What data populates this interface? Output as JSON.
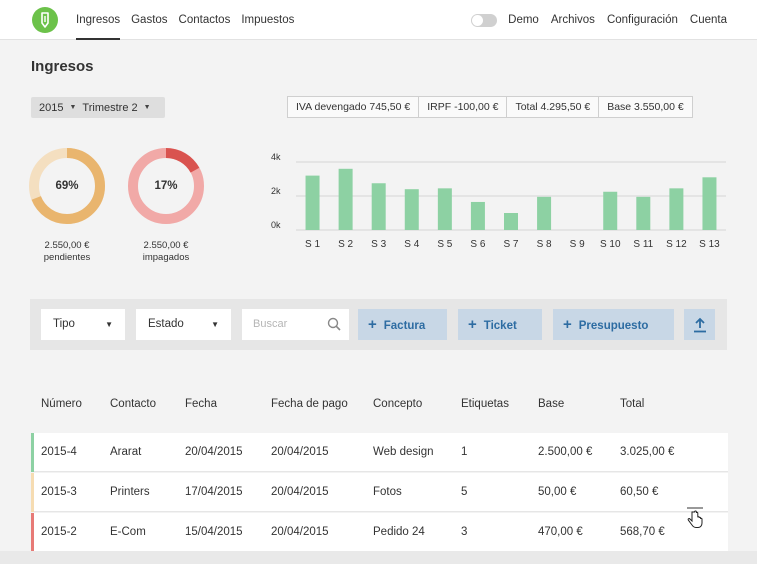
{
  "nav": {
    "items": [
      "Ingresos",
      "Gastos",
      "Contactos",
      "Impuestos"
    ],
    "active": 0,
    "right": {
      "demo": "Demo",
      "archivos": "Archivos",
      "config": "Configuración",
      "cuenta": "Cuenta"
    }
  },
  "page": {
    "title": "Ingresos"
  },
  "period": {
    "year": "2015",
    "quarter": "Trimestre 2"
  },
  "totals": {
    "iva": "IVA devengado 745,50 €",
    "irpf": "IRPF -100,00 €",
    "total": "Total 4.295,50 €",
    "base": "Base 3.550,00 €"
  },
  "donuts": [
    {
      "percent": "69%",
      "value": 0.69,
      "amount": "2.550,00 €",
      "label": "pendientes",
      "color": "#e9b56e",
      "track": "#f4dfc0"
    },
    {
      "percent": "17%",
      "value": 0.17,
      "amount": "2.550,00 €",
      "label": "impagados",
      "color": "#d9534f",
      "track": "#f1a9a7"
    }
  ],
  "chart_data": {
    "type": "bar",
    "categories": [
      "S 1",
      "S 2",
      "S 3",
      "S 4",
      "S 5",
      "S 6",
      "S 7",
      "S 8",
      "S 9",
      "S 10",
      "S 11",
      "S 12",
      "S 13"
    ],
    "values": [
      3200,
      3600,
      2750,
      2400,
      2450,
      1650,
      1000,
      1950,
      0,
      2250,
      1950,
      2450,
      3100
    ],
    "yticks": [
      "4k",
      "2k",
      "0k"
    ],
    "ylim": [
      0,
      4000
    ],
    "color": "#8dd1a3"
  },
  "filters": {
    "tipo": "Tipo",
    "estado": "Estado",
    "search_placeholder": "Buscar",
    "btn_factura": "Factura",
    "btn_ticket": "Ticket",
    "btn_presupuesto": "Presupuesto"
  },
  "table": {
    "headers": [
      "Número",
      "Contacto",
      "Fecha",
      "Fecha de pago",
      "Concepto",
      "Etiquetas",
      "Base",
      "Total"
    ],
    "rows": [
      {
        "numero": "2015-4",
        "contacto": "Ararat",
        "fecha": "20/04/2015",
        "pago": "20/04/2015",
        "concepto": "Web design",
        "etiquetas": "1",
        "base": "2.500,00 €",
        "total": "3.025,00 €",
        "edge": "#8dd1a3"
      },
      {
        "numero": "2015-3",
        "contacto": "Printers",
        "fecha": "17/04/2015",
        "pago": "20/04/2015",
        "concepto": "Fotos",
        "etiquetas": "5",
        "base": "50,00 €",
        "total": "60,50 €",
        "edge": "#f6dcb2"
      },
      {
        "numero": "2015-2",
        "contacto": "E-Com",
        "fecha": "15/04/2015",
        "pago": "20/04/2015",
        "concepto": "Pedido 24",
        "etiquetas": "3",
        "base": "470,00 €",
        "total": "568,70 €",
        "edge": "#e77a76"
      }
    ]
  }
}
